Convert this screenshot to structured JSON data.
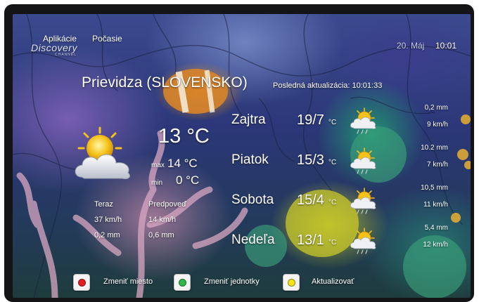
{
  "menu": {
    "apps": "Aplikácie",
    "weather": "Počasie"
  },
  "brand": {
    "logo_text": "Discovery",
    "logo_sub": "CHANNEL"
  },
  "header": {
    "date": "20. Máj",
    "time": "10:01"
  },
  "location": {
    "city": "Prievidza (SLOVENSKO)",
    "updated": "Posledná aktualizácia: 10:01:33"
  },
  "current": {
    "temp": "13 °C",
    "max_label": "max",
    "max_value": "14 °C",
    "min_label": "min",
    "min_value": "0 °C",
    "icon": "partly-cloudy-icon",
    "now_label": "Teraz",
    "now_wind": "37 km/h",
    "now_rain": "0,2 mm",
    "forecast_label": "Predpoveď",
    "forecast_wind": "14 km/h",
    "forecast_rain": "0,6 mm"
  },
  "forecast": [
    {
      "day": "Zajtra",
      "temps": "19/7",
      "unit": "°C",
      "rain": "0,2 mm",
      "wind": "9 km/h",
      "icon": "partly-cloudy-rain-icon"
    },
    {
      "day": "Piatok",
      "temps": "15/3",
      "unit": "°C",
      "rain": "10.2 mm",
      "wind": "7 km/h",
      "icon": "partly-cloudy-rain-icon"
    },
    {
      "day": "Sobota",
      "temps": "15/4",
      "unit": "°C",
      "rain": "10,5 mm",
      "wind": "11 km/h",
      "icon": "partly-cloudy-rain-icon"
    },
    {
      "day": "Nedeľa",
      "temps": "13/1",
      "unit": "°C",
      "rain": "5,4 mm",
      "wind": "12 km/h",
      "icon": "partly-cloudy-rain-icon"
    }
  ],
  "buttons": [
    {
      "label": "Zmeniť miesto",
      "color": "#e02020"
    },
    {
      "label": "Zmeniť jednotky",
      "color": "#2fb84a"
    },
    {
      "label": "Aktualizovať",
      "color": "#f2e51c"
    }
  ]
}
